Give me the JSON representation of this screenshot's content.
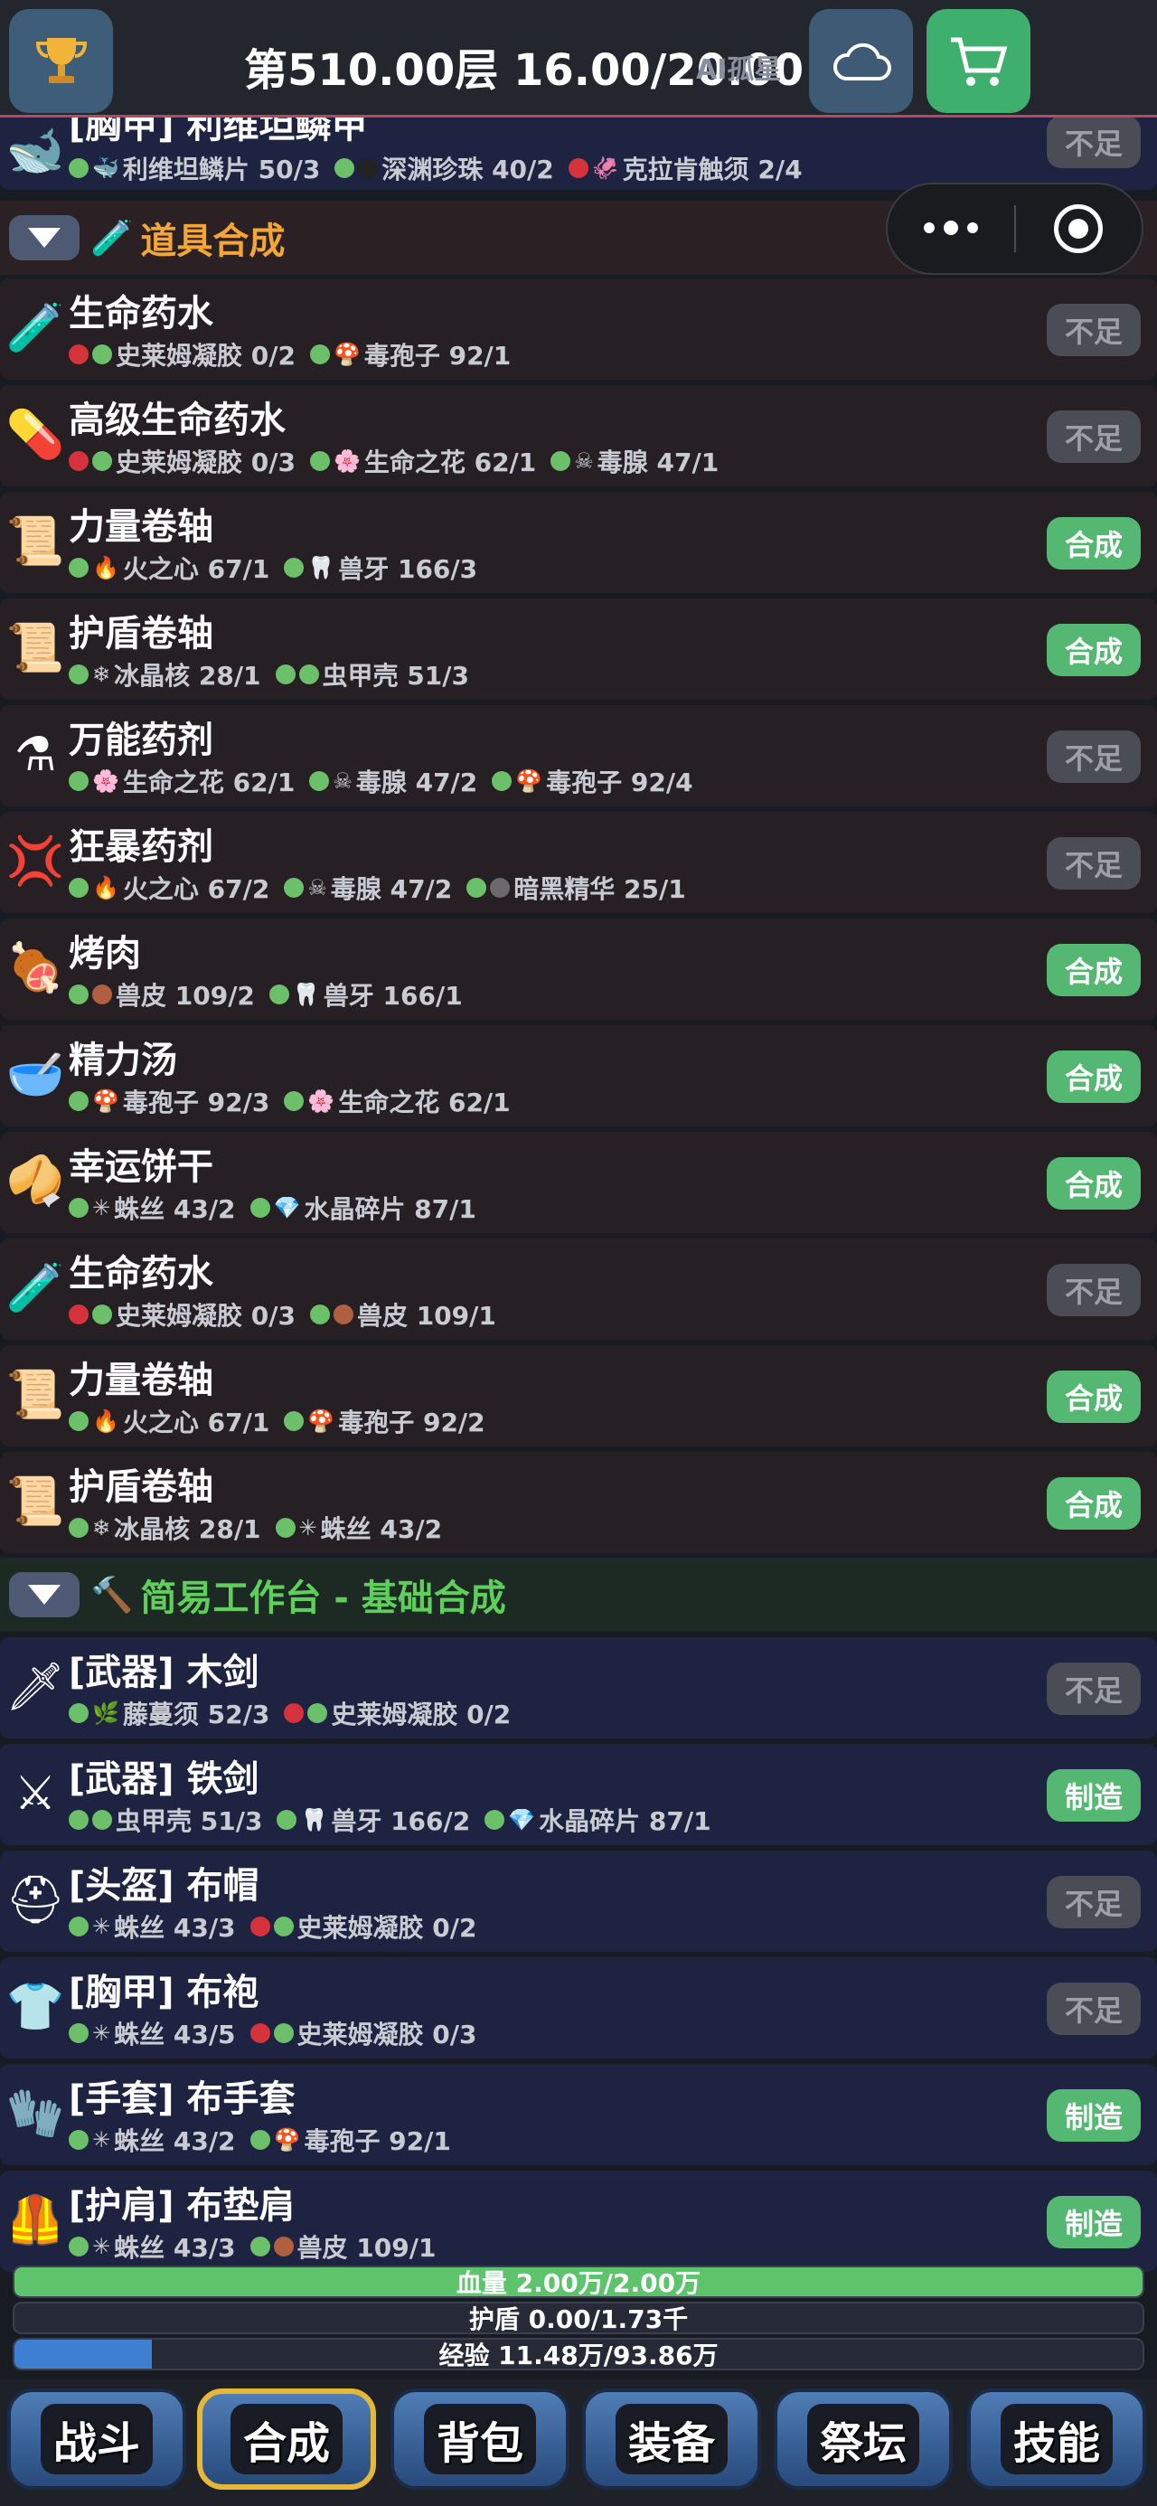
{
  "header": {
    "title": "第510.00层 16.00/20.00",
    "watermark": "AI孤星"
  },
  "capsule": {
    "menu_icon": "more-dots-icon",
    "close_icon": "target-icon"
  },
  "top_partial_row": {
    "name": "[胸甲] 利维坦鳞甲",
    "materials": [
      {
        "dot": "g",
        "sym": "🐳",
        "text": "利维坦鳞片 50/3"
      },
      {
        "dot": "g",
        "sym": "⚫",
        "text": "深渊珍珠 40/2"
      },
      {
        "dot": "r",
        "sym": "🦑",
        "text": "克拉肯触须 2/4"
      }
    ],
    "button": "不足"
  },
  "sections": {
    "items": {
      "title": "道具合成"
    },
    "bench": {
      "title": "简易工作台 - 基础合成"
    }
  },
  "item_rows": [
    {
      "icon": "🧪",
      "name": "生命药水",
      "button": "不足",
      "ok": false,
      "materials": [
        {
          "dots": [
            "r",
            "g"
          ],
          "sym": "",
          "text": "史莱姆凝胶 0/2"
        },
        {
          "dots": [
            "g"
          ],
          "sym": "🍄",
          "text": "毒孢子 92/1"
        }
      ]
    },
    {
      "icon": "💊",
      "name": "高级生命药水",
      "button": "不足",
      "ok": false,
      "materials": [
        {
          "dots": [
            "r",
            "g"
          ],
          "sym": "",
          "text": "史莱姆凝胶 0/3"
        },
        {
          "dots": [
            "g"
          ],
          "sym": "🌸",
          "text": "生命之花 62/1"
        },
        {
          "dots": [
            "g"
          ],
          "sym": "☠",
          "text": "毒腺 47/1"
        }
      ]
    },
    {
      "icon": "📜",
      "name": "力量卷轴",
      "button": "合成",
      "ok": true,
      "materials": [
        {
          "dots": [
            "g"
          ],
          "sym": "🔥",
          "text": "火之心 67/1"
        },
        {
          "dots": [
            "g"
          ],
          "sym": "🦷",
          "text": "兽牙 166/3"
        }
      ]
    },
    {
      "icon": "📜",
      "name": "护盾卷轴",
      "button": "合成",
      "ok": true,
      "materials": [
        {
          "dots": [
            "g"
          ],
          "sym": "❄",
          "text": "冰晶核 28/1"
        },
        {
          "dots": [
            "g",
            "g"
          ],
          "sym": "",
          "text": "虫甲壳 51/3"
        }
      ]
    },
    {
      "icon": "⚗",
      "name": "万能药剂",
      "button": "不足",
      "ok": false,
      "materials": [
        {
          "dots": [
            "g"
          ],
          "sym": "🌸",
          "text": "生命之花 62/1"
        },
        {
          "dots": [
            "g"
          ],
          "sym": "☠",
          "text": "毒腺 47/2"
        },
        {
          "dots": [
            "g"
          ],
          "sym": "🍄",
          "text": "毒孢子 92/4"
        }
      ]
    },
    {
      "icon": "💢",
      "name": "狂暴药剂",
      "button": "不足",
      "ok": false,
      "materials": [
        {
          "dots": [
            "g"
          ],
          "sym": "🔥",
          "text": "火之心 67/2"
        },
        {
          "dots": [
            "g"
          ],
          "sym": "☠",
          "text": "毒腺 47/2"
        },
        {
          "dots": [
            "g",
            "gy"
          ],
          "sym": "",
          "text": "暗黑精华 25/1"
        }
      ]
    },
    {
      "icon": "🍖",
      "name": "烤肉",
      "button": "合成",
      "ok": true,
      "materials": [
        {
          "dots": [
            "g",
            "br"
          ],
          "sym": "",
          "text": "兽皮 109/2"
        },
        {
          "dots": [
            "g"
          ],
          "sym": "🦷",
          "text": "兽牙 166/1"
        }
      ]
    },
    {
      "icon": "🥣",
      "name": "精力汤",
      "button": "合成",
      "ok": true,
      "materials": [
        {
          "dots": [
            "g"
          ],
          "sym": "🍄",
          "text": "毒孢子 92/3"
        },
        {
          "dots": [
            "g"
          ],
          "sym": "🌸",
          "text": "生命之花 62/1"
        }
      ]
    },
    {
      "icon": "🥠",
      "name": "幸运饼干",
      "button": "合成",
      "ok": true,
      "materials": [
        {
          "dots": [
            "g"
          ],
          "sym": "✳",
          "text": "蛛丝 43/2"
        },
        {
          "dots": [
            "g"
          ],
          "sym": "💎",
          "text": "水晶碎片 87/1"
        }
      ]
    },
    {
      "icon": "🧪",
      "name": "生命药水",
      "button": "不足",
      "ok": false,
      "materials": [
        {
          "dots": [
            "r",
            "g"
          ],
          "sym": "",
          "text": "史莱姆凝胶 0/3"
        },
        {
          "dots": [
            "g",
            "br"
          ],
          "sym": "",
          "text": "兽皮 109/1"
        }
      ]
    },
    {
      "icon": "📜",
      "name": "力量卷轴",
      "button": "合成",
      "ok": true,
      "materials": [
        {
          "dots": [
            "g"
          ],
          "sym": "🔥",
          "text": "火之心 67/1"
        },
        {
          "dots": [
            "g"
          ],
          "sym": "🍄",
          "text": "毒孢子 92/2"
        }
      ]
    },
    {
      "icon": "📜",
      "name": "护盾卷轴",
      "button": "合成",
      "ok": true,
      "materials": [
        {
          "dots": [
            "g"
          ],
          "sym": "❄",
          "text": "冰晶核 28/1"
        },
        {
          "dots": [
            "g"
          ],
          "sym": "✳",
          "text": "蛛丝 43/2"
        }
      ]
    }
  ],
  "bench_rows": [
    {
      "icon": "🗡",
      "name": "[武器] 木剑",
      "button": "不足",
      "ok": false,
      "materials": [
        {
          "dots": [
            "g"
          ],
          "sym": "🌿",
          "text": "藤蔓须 52/3"
        },
        {
          "dots": [
            "r",
            "g"
          ],
          "sym": "",
          "text": "史莱姆凝胶 0/2"
        }
      ]
    },
    {
      "icon": "⚔",
      "name": "[武器] 铁剑",
      "button": "制造",
      "ok": true,
      "materials": [
        {
          "dots": [
            "g",
            "g"
          ],
          "sym": "",
          "text": "虫甲壳 51/3"
        },
        {
          "dots": [
            "g"
          ],
          "sym": "🦷",
          "text": "兽牙 166/2"
        },
        {
          "dots": [
            "g"
          ],
          "sym": "💎",
          "text": "水晶碎片 87/1"
        }
      ]
    },
    {
      "icon": "⛑",
      "name": "[头盔] 布帽",
      "button": "不足",
      "ok": false,
      "materials": [
        {
          "dots": [
            "g"
          ],
          "sym": "✳",
          "text": "蛛丝 43/3"
        },
        {
          "dots": [
            "r",
            "g"
          ],
          "sym": "",
          "text": "史莱姆凝胶 0/2"
        }
      ]
    },
    {
      "icon": "👕",
      "name": "[胸甲] 布袍",
      "button": "不足",
      "ok": false,
      "materials": [
        {
          "dots": [
            "g"
          ],
          "sym": "✳",
          "text": "蛛丝 43/5"
        },
        {
          "dots": [
            "r",
            "g"
          ],
          "sym": "",
          "text": "史莱姆凝胶 0/3"
        }
      ]
    },
    {
      "icon": "🧤",
      "name": "[手套] 布手套",
      "button": "制造",
      "ok": true,
      "materials": [
        {
          "dots": [
            "g"
          ],
          "sym": "✳",
          "text": "蛛丝 43/2"
        },
        {
          "dots": [
            "g"
          ],
          "sym": "🍄",
          "text": "毒孢子 92/1"
        }
      ]
    },
    {
      "icon": "🦺",
      "name": "[护肩] 布垫肩",
      "button": "制造",
      "ok": true,
      "materials": [
        {
          "dots": [
            "g"
          ],
          "sym": "✳",
          "text": "蛛丝 43/3"
        },
        {
          "dots": [
            "g",
            "br"
          ],
          "sym": "",
          "text": "兽皮 109/1"
        }
      ]
    }
  ],
  "bars": {
    "hp": {
      "label": "血量 2.00万/2.00万",
      "fraction": 1.0,
      "color": "#5ec46b"
    },
    "shield": {
      "label": "护盾 0.00/1.73千",
      "fraction": 0.0,
      "color": "#4d8ad8"
    },
    "exp": {
      "label": "经验 11.48万/93.86万",
      "fraction": 0.122,
      "color": "#3f7fd1"
    }
  },
  "tabs": [
    {
      "label": "战斗",
      "active": false
    },
    {
      "label": "合成",
      "active": true
    },
    {
      "label": "背包",
      "active": false
    },
    {
      "label": "装备",
      "active": false
    },
    {
      "label": "祭坛",
      "active": false
    },
    {
      "label": "技能",
      "active": false
    }
  ],
  "colors": {
    "accent_orange": "#f3a535",
    "accent_green": "#5fcf5b",
    "ok_button": "#54b872",
    "no_button": "#4a4d55"
  }
}
